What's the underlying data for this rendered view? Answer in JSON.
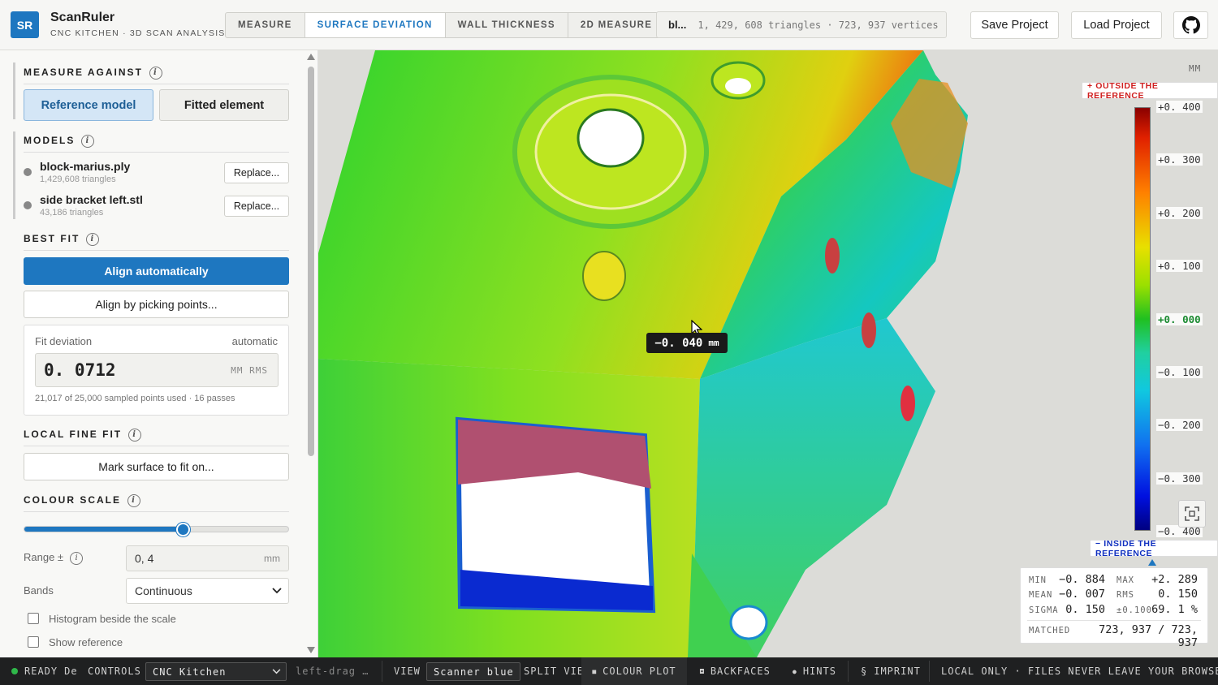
{
  "header": {
    "logo": "SR",
    "title": "ScanRuler",
    "subtitle": "CNC KITCHEN · 3D SCAN ANALYSIS",
    "tabs": [
      {
        "label": "MEASURE",
        "active": false
      },
      {
        "label": "SURFACE DEVIATION",
        "active": true
      },
      {
        "label": "WALL THICKNESS",
        "active": false
      },
      {
        "label": "2D MEASURE",
        "active": false
      }
    ],
    "mesh_file": "bl...",
    "mesh_stats": "1, 429, 608 triangles · 723, 937 vertices",
    "save_label": "Save Project",
    "load_label": "Load Project",
    "github_icon": "github-icon"
  },
  "sidebar": {
    "measure_against": {
      "title": "MEASURE AGAINST",
      "options": [
        "Reference model",
        "Fitted element"
      ],
      "selected": "Reference model"
    },
    "models": {
      "title": "MODELS",
      "items": [
        {
          "name": "block-marius.ply",
          "sub": "1,429,608 triangles",
          "action": "Replace..."
        },
        {
          "name": "side bracket left.stl",
          "sub": "43,186 triangles",
          "action": "Replace..."
        }
      ]
    },
    "best_fit": {
      "title": "BEST FIT",
      "align_auto": "Align automatically",
      "align_pick": "Align by picking points...",
      "fit_label": "Fit deviation",
      "fit_mode": "automatic",
      "fit_value": "0. 0712",
      "fit_unit": "MM RMS",
      "fit_note": "21,017 of 25,000 sampled points used · 16 passes"
    },
    "local_fine_fit": {
      "title": "LOCAL FINE FIT",
      "mark_label": "Mark surface to fit on..."
    },
    "colour_scale": {
      "title": "COLOUR SCALE",
      "slider_value": 0.6,
      "range_label": "Range ±",
      "range_value": "0, 4",
      "range_unit": "mm",
      "bands_label": "Bands",
      "bands_value": "Continuous",
      "histogram_label": "Histogram beside the scale",
      "histogram_checked": false,
      "reference_label": "Show reference",
      "reference_checked": false
    }
  },
  "viewport": {
    "tooltip_value": "−0. 040",
    "tooltip_unit": "mm",
    "legend": {
      "unit": "MM",
      "outside_label": "+ OUTSIDE THE REFERENCE",
      "inside_label": "− INSIDE THE REFERENCE",
      "ticks": [
        "+0. 400",
        "+0. 300",
        "+0. 200",
        "+0. 100",
        "+0. 000",
        "−0. 100",
        "−0. 200",
        "−0. 300",
        "−0. 400"
      ]
    },
    "stats": {
      "min_label": "MIN",
      "min": "−0. 884",
      "max_label": "MAX",
      "max": "+2. 289",
      "mean_label": "MEAN",
      "mean": "−0. 007",
      "rms_label": "RMS",
      "rms": "0. 150",
      "sigma_label": "SIGMA",
      "sigma": "0. 150",
      "within_label": "±0.100",
      "within": "69. 1 %",
      "matched_label": "MATCHED",
      "matched": "723, 937 / 723, 937"
    }
  },
  "status": {
    "ready": "READY",
    "ready_tail": "De",
    "controls_label": "CONTROLS",
    "controls_value": "CNC Kitchen",
    "hint": "left-drag …",
    "view_label": "VIEW",
    "view_value": "Scanner blue",
    "split": "SPLIT VIEW",
    "colour_plot": "COLOUR PLOT",
    "backfaces": "BACKFACES",
    "hints": "HINTS",
    "imprint": "IMPRINT",
    "local": "LOCAL ONLY · FILES NEVER LEAVE YOUR BROWSER"
  },
  "colors": {
    "accent": "#1e77c0",
    "status_ready": "#2fb84a"
  }
}
